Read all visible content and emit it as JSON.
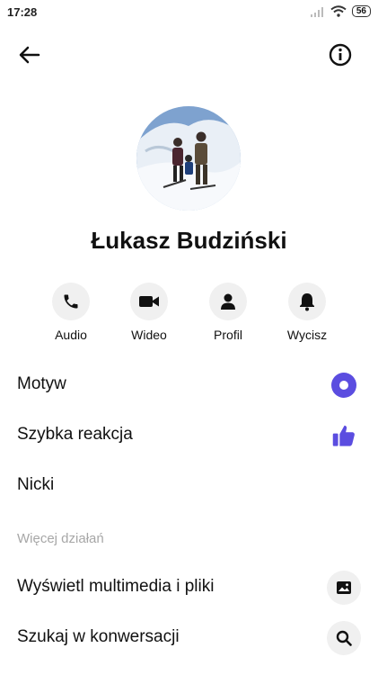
{
  "status_bar": {
    "time": "17:28",
    "battery": "56"
  },
  "header": {
    "back_icon": "arrow-left-icon",
    "info_icon": "info-circle-icon"
  },
  "profile": {
    "name": "Łukasz Budziński"
  },
  "actions": [
    {
      "label": "Audio",
      "icon": "phone-icon"
    },
    {
      "label": "Wideo",
      "icon": "video-camera-icon"
    },
    {
      "label": "Profil",
      "icon": "person-icon"
    },
    {
      "label": "Wycisz",
      "icon": "bell-icon"
    }
  ],
  "settings": {
    "theme_label": "Motyw",
    "quick_reaction_label": "Szybka reakcja",
    "nicknames_label": "Nicki"
  },
  "more_actions": {
    "section_title": "Więcej działań",
    "media_label": "Wyświetl multimedia i pliki",
    "search_label": "Szukaj w konwersacji"
  },
  "colors": {
    "accent": "#5b4de0"
  }
}
